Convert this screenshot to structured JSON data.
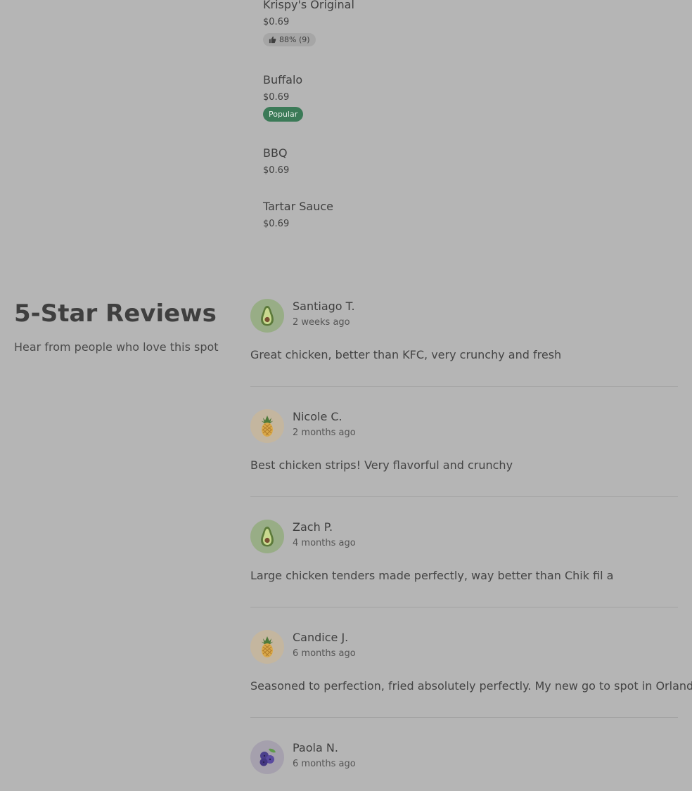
{
  "menu": {
    "items": [
      {
        "name": "Krispy's Original",
        "price": "$0.69",
        "rating": "88% (9)"
      },
      {
        "name": "Buffalo",
        "price": "$0.69",
        "badge": "Popular"
      },
      {
        "name": "BBQ",
        "price": "$0.69"
      },
      {
        "name": "Tartar Sauce",
        "price": "$0.69"
      }
    ]
  },
  "reviews_section": {
    "title": "5-Star Reviews",
    "subtitle": "Hear from people who love this spot"
  },
  "reviews": [
    {
      "name": "Santiago T.",
      "date": "2 weeks ago",
      "text": "Great chicken, better than KFC, very crunchy and fresh",
      "avatar": "avocado-icon"
    },
    {
      "name": "Nicole C.",
      "date": "2 months ago",
      "text": "Best chicken strips! Very flavorful and crunchy",
      "avatar": "pineapple-icon"
    },
    {
      "name": "Zach P.",
      "date": "4 months ago",
      "text": "Large chicken tenders made perfectly, way better than Chik fil a",
      "avatar": "avocado-icon"
    },
    {
      "name": "Candice J.",
      "date": "6 months ago",
      "text": "Seasoned to perfection, fried absolutely perfectly. My new go to spot in Orlando!",
      "avatar": "pineapple-icon"
    },
    {
      "name": "Paola N.",
      "date": "6 months ago",
      "text": "",
      "avatar": "blueberry-icon"
    }
  ],
  "colors": {
    "background": "#b5b5b5",
    "popular_badge": "#3b7a57",
    "avocado_avatar": "#98ad86",
    "pineapple_avatar": "#c4b69f",
    "blueberry_avatar": "#a5a0ad"
  }
}
